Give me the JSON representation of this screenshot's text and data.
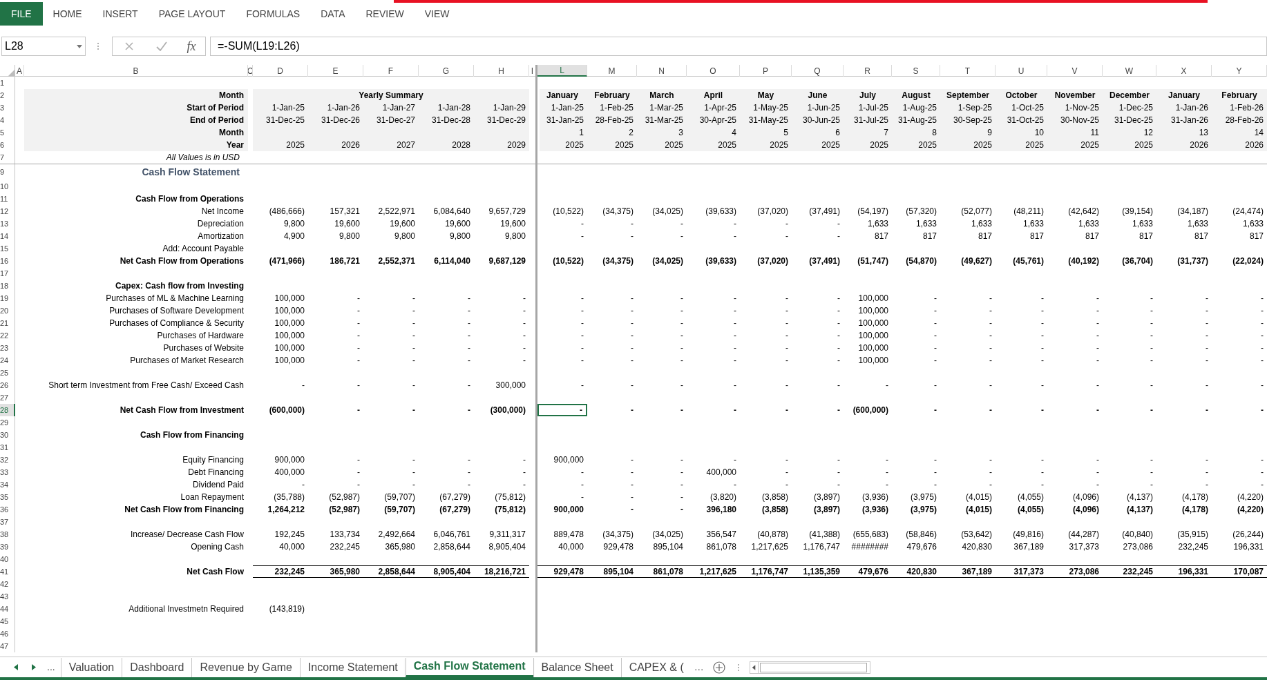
{
  "ribbon_tabs": [
    {
      "label": "FILE",
      "kind": "file"
    },
    {
      "label": "HOME",
      "kind": "tab"
    },
    {
      "label": "INSERT",
      "kind": "tab"
    },
    {
      "label": "PAGE LAYOUT",
      "kind": "tab"
    },
    {
      "label": "FORMULAS",
      "kind": "tab"
    },
    {
      "label": "DATA",
      "kind": "tab"
    },
    {
      "label": "REVIEW",
      "kind": "tab"
    },
    {
      "label": "VIEW",
      "kind": "tab"
    }
  ],
  "formula_bar": {
    "name_box": "L28",
    "function_label": "fx",
    "formula": "=-SUM(L19:L26)"
  },
  "columns": [
    {
      "label": "A",
      "selected": false
    },
    {
      "label": "B",
      "selected": false
    },
    {
      "label": "C",
      "selected": false
    },
    {
      "label": "D",
      "selected": false
    },
    {
      "label": "E",
      "selected": false
    },
    {
      "label": "F",
      "selected": false
    },
    {
      "label": "G",
      "selected": false
    },
    {
      "label": "H",
      "selected": false
    },
    {
      "label": "I",
      "selected": false
    },
    {
      "label": "L",
      "selected": true
    },
    {
      "label": "M",
      "selected": false
    },
    {
      "label": "N",
      "selected": false
    },
    {
      "label": "O",
      "selected": false
    },
    {
      "label": "P",
      "selected": false
    },
    {
      "label": "Q",
      "selected": false
    },
    {
      "label": "R",
      "selected": false
    },
    {
      "label": "S",
      "selected": false
    },
    {
      "label": "T",
      "selected": false
    },
    {
      "label": "U",
      "selected": false
    },
    {
      "label": "V",
      "selected": false
    },
    {
      "label": "W",
      "selected": false
    },
    {
      "label": "X",
      "selected": false
    },
    {
      "label": "Y",
      "selected": false
    }
  ],
  "rows": [
    {
      "num": "1",
      "kind": "blank",
      "selected": false
    },
    {
      "num": "2",
      "kind": "month_names",
      "selected": false,
      "label": "Month",
      "yearly_title": "Yearly Summary",
      "monthly": [
        "January",
        "February",
        "March",
        "April",
        "May",
        "June",
        "July",
        "August",
        "September",
        "October",
        "November",
        "December",
        "January",
        "February"
      ]
    },
    {
      "num": "3",
      "kind": "header",
      "selected": false,
      "label": "Start of Period",
      "yearly": [
        "1-Jan-25",
        "1-Jan-26",
        "1-Jan-27",
        "1-Jan-28",
        "1-Jan-29"
      ],
      "monthly": [
        "1-Jan-25",
        "1-Feb-25",
        "1-Mar-25",
        "1-Apr-25",
        "1-May-25",
        "1-Jun-25",
        "1-Jul-25",
        "1-Aug-25",
        "1-Sep-25",
        "1-Oct-25",
        "1-Nov-25",
        "1-Dec-25",
        "1-Jan-26",
        "1-Feb-26"
      ]
    },
    {
      "num": "4",
      "kind": "header",
      "selected": false,
      "label": "End of Period",
      "yearly": [
        "31-Dec-25",
        "31-Dec-26",
        "31-Dec-27",
        "31-Dec-28",
        "31-Dec-29"
      ],
      "monthly": [
        "31-Jan-25",
        "28-Feb-25",
        "31-Mar-25",
        "30-Apr-25",
        "31-May-25",
        "30-Jun-25",
        "31-Jul-25",
        "31-Aug-25",
        "30-Sep-25",
        "31-Oct-25",
        "30-Nov-25",
        "31-Dec-25",
        "31-Jan-26",
        "28-Feb-26"
      ]
    },
    {
      "num": "5",
      "kind": "header",
      "selected": false,
      "label": "Month",
      "monthly": [
        "1",
        "2",
        "3",
        "4",
        "5",
        "6",
        "7",
        "8",
        "9",
        "10",
        "11",
        "12",
        "13",
        "14"
      ]
    },
    {
      "num": "6",
      "kind": "header",
      "selected": false,
      "label": "Year",
      "yearly": [
        "2025",
        "2026",
        "2027",
        "2028",
        "2029"
      ],
      "monthly": [
        "2025",
        "2025",
        "2025",
        "2025",
        "2025",
        "2025",
        "2025",
        "2025",
        "2025",
        "2025",
        "2025",
        "2025",
        "2026",
        "2026"
      ]
    },
    {
      "num": "7",
      "kind": "note",
      "selected": false,
      "label": "All Values is in USD"
    },
    {
      "num": "9",
      "kind": "title",
      "selected": false,
      "label": "Cash Flow Statement"
    },
    {
      "num": "10",
      "kind": "blank",
      "selected": false
    },
    {
      "num": "11",
      "kind": "section",
      "selected": false,
      "label": "Cash Flow from Operations"
    },
    {
      "num": "12",
      "kind": "item",
      "selected": false,
      "label": "Net Income",
      "yearly": [
        "(486,666)",
        "157,321",
        "2,522,971",
        "6,084,640",
        "9,657,729"
      ],
      "monthly": [
        "(10,522)",
        "(34,375)",
        "(34,025)",
        "(39,633)",
        "(37,020)",
        "(37,491)",
        "(54,197)",
        "(57,320)",
        "(52,077)",
        "(48,211)",
        "(42,642)",
        "(39,154)",
        "(34,187)",
        "(24,474)"
      ]
    },
    {
      "num": "13",
      "kind": "item",
      "selected": false,
      "label": "Depreciation",
      "yearly": [
        "9,800",
        "19,600",
        "19,600",
        "19,600",
        "19,600"
      ],
      "monthly": [
        "-",
        "-",
        "-",
        "-",
        "-",
        "-",
        "1,633",
        "1,633",
        "1,633",
        "1,633",
        "1,633",
        "1,633",
        "1,633",
        "1,633"
      ]
    },
    {
      "num": "14",
      "kind": "item",
      "selected": false,
      "label": "Amortization",
      "yearly": [
        "4,900",
        "9,800",
        "9,800",
        "9,800",
        "9,800"
      ],
      "monthly": [
        "-",
        "-",
        "-",
        "-",
        "-",
        "-",
        "817",
        "817",
        "817",
        "817",
        "817",
        "817",
        "817",
        "817"
      ]
    },
    {
      "num": "15",
      "kind": "item",
      "selected": false,
      "label": "Add: Account Payable"
    },
    {
      "num": "16",
      "kind": "total",
      "selected": false,
      "label": "Net Cash Flow from Operations",
      "yearly": [
        "(471,966)",
        "186,721",
        "2,552,371",
        "6,114,040",
        "9,687,129"
      ],
      "monthly": [
        "(10,522)",
        "(34,375)",
        "(34,025)",
        "(39,633)",
        "(37,020)",
        "(37,491)",
        "(51,747)",
        "(54,870)",
        "(49,627)",
        "(45,761)",
        "(40,192)",
        "(36,704)",
        "(31,737)",
        "(22,024)"
      ]
    },
    {
      "num": "17",
      "kind": "blank",
      "selected": false
    },
    {
      "num": "18",
      "kind": "section",
      "selected": false,
      "label": "Capex: Cash flow from Investing"
    },
    {
      "num": "19",
      "kind": "item",
      "selected": false,
      "label": "Purchases of ML & Machine Learning",
      "yearly": [
        "100,000",
        "-",
        "-",
        "-",
        "-"
      ],
      "monthly": [
        "-",
        "-",
        "-",
        "-",
        "-",
        "-",
        "100,000",
        "-",
        "-",
        "-",
        "-",
        "-",
        "-",
        "-"
      ]
    },
    {
      "num": "20",
      "kind": "item",
      "selected": false,
      "label": "Purchases of Software Development",
      "yearly": [
        "100,000",
        "-",
        "-",
        "-",
        "-"
      ],
      "monthly": [
        "-",
        "-",
        "-",
        "-",
        "-",
        "-",
        "100,000",
        "-",
        "-",
        "-",
        "-",
        "-",
        "-",
        "-"
      ]
    },
    {
      "num": "21",
      "kind": "item",
      "selected": false,
      "label": "Purchases of Compliance & Security",
      "yearly": [
        "100,000",
        "-",
        "-",
        "-",
        "-"
      ],
      "monthly": [
        "-",
        "-",
        "-",
        "-",
        "-",
        "-",
        "100,000",
        "-",
        "-",
        "-",
        "-",
        "-",
        "-",
        "-"
      ]
    },
    {
      "num": "22",
      "kind": "item",
      "selected": false,
      "label": "Purchases of Hardware",
      "yearly": [
        "100,000",
        "-",
        "-",
        "-",
        "-"
      ],
      "monthly": [
        "-",
        "-",
        "-",
        "-",
        "-",
        "-",
        "100,000",
        "-",
        "-",
        "-",
        "-",
        "-",
        "-",
        "-"
      ]
    },
    {
      "num": "23",
      "kind": "item",
      "selected": false,
      "label": "Purchases of Website",
      "yearly": [
        "100,000",
        "-",
        "-",
        "-",
        "-"
      ],
      "monthly": [
        "-",
        "-",
        "-",
        "-",
        "-",
        "-",
        "100,000",
        "-",
        "-",
        "-",
        "-",
        "-",
        "-",
        "-"
      ]
    },
    {
      "num": "24",
      "kind": "item",
      "selected": false,
      "label": "Purchases of Market Research",
      "yearly": [
        "100,000",
        "-",
        "-",
        "-",
        "-"
      ],
      "monthly": [
        "-",
        "-",
        "-",
        "-",
        "-",
        "-",
        "100,000",
        "-",
        "-",
        "-",
        "-",
        "-",
        "-",
        "-"
      ]
    },
    {
      "num": "25",
      "kind": "blank",
      "selected": false
    },
    {
      "num": "26",
      "kind": "item",
      "selected": false,
      "label": "Short term Investment from Free Cash/ Exceed Cash",
      "yearly": [
        "-",
        "-",
        "-",
        "-",
        "300,000"
      ],
      "monthly": [
        "-",
        "-",
        "-",
        "-",
        "-",
        "-",
        "-",
        "-",
        "-",
        "-",
        "-",
        "-",
        "-",
        "-"
      ]
    },
    {
      "num": "27",
      "kind": "blank",
      "selected": false
    },
    {
      "num": "28",
      "kind": "total",
      "selected": true,
      "label": "Net Cash Flow from Investment",
      "yearly": [
        "(600,000)",
        "-",
        "-",
        "-",
        "(300,000)"
      ],
      "monthly": [
        "-",
        "-",
        "-",
        "-",
        "-",
        "-",
        "(600,000)",
        "-",
        "-",
        "-",
        "-",
        "-",
        "-",
        "-"
      ]
    },
    {
      "num": "29",
      "kind": "blank",
      "selected": false
    },
    {
      "num": "30",
      "kind": "section",
      "selected": false,
      "label": "Cash Flow from Financing"
    },
    {
      "num": "31",
      "kind": "blank",
      "selected": false
    },
    {
      "num": "32",
      "kind": "item",
      "selected": false,
      "label": "Equity Financing",
      "yearly": [
        "900,000",
        "-",
        "-",
        "-",
        "-"
      ],
      "monthly": [
        "900,000",
        "-",
        "-",
        "-",
        "-",
        "-",
        "-",
        "-",
        "-",
        "-",
        "-",
        "-",
        "-",
        "-"
      ]
    },
    {
      "num": "33",
      "kind": "item",
      "selected": false,
      "label": "Debt Financing",
      "yearly": [
        "400,000",
        "-",
        "-",
        "-",
        "-"
      ],
      "monthly": [
        "-",
        "-",
        "-",
        "400,000",
        "-",
        "-",
        "-",
        "-",
        "-",
        "-",
        "-",
        "-",
        "-",
        "-"
      ]
    },
    {
      "num": "34",
      "kind": "item",
      "selected": false,
      "label": "Dividend  Paid",
      "yearly": [
        "-",
        "-",
        "-",
        "-",
        "-"
      ],
      "monthly": [
        "-",
        "-",
        "-",
        "-",
        "-",
        "-",
        "-",
        "-",
        "-",
        "-",
        "-",
        "-",
        "-",
        "-"
      ]
    },
    {
      "num": "35",
      "kind": "item",
      "selected": false,
      "label": "Loan Repayment",
      "yearly": [
        "(35,788)",
        "(52,987)",
        "(59,707)",
        "(67,279)",
        "(75,812)"
      ],
      "monthly": [
        "-",
        "-",
        "-",
        "(3,820)",
        "(3,858)",
        "(3,897)",
        "(3,936)",
        "(3,975)",
        "(4,015)",
        "(4,055)",
        "(4,096)",
        "(4,137)",
        "(4,178)",
        "(4,220)"
      ]
    },
    {
      "num": "36",
      "kind": "total",
      "selected": false,
      "label": "Net Cash Flow from Financing",
      "yearly": [
        "1,264,212",
        "(52,987)",
        "(59,707)",
        "(67,279)",
        "(75,812)"
      ],
      "monthly": [
        "900,000",
        "-",
        "-",
        "396,180",
        "(3,858)",
        "(3,897)",
        "(3,936)",
        "(3,975)",
        "(4,015)",
        "(4,055)",
        "(4,096)",
        "(4,137)",
        "(4,178)",
        "(4,220)"
      ]
    },
    {
      "num": "37",
      "kind": "blank",
      "selected": false
    },
    {
      "num": "38",
      "kind": "item",
      "selected": false,
      "label": "Increase/ Decrease Cash Flow",
      "yearly": [
        "192,245",
        "133,734",
        "2,492,664",
        "6,046,761",
        "9,311,317"
      ],
      "monthly": [
        "889,478",
        "(34,375)",
        "(34,025)",
        "356,547",
        "(40,878)",
        "(41,388)",
        "(655,683)",
        "(58,846)",
        "(53,642)",
        "(49,816)",
        "(44,287)",
        "(40,840)",
        "(35,915)",
        "(26,244)"
      ]
    },
    {
      "num": "39",
      "kind": "item",
      "selected": false,
      "label": "Opening Cash",
      "yearly": [
        "40,000",
        "232,245",
        "365,980",
        "2,858,644",
        "8,905,404"
      ],
      "monthly": [
        "40,000",
        "929,478",
        "895,104",
        "861,078",
        "1,217,625",
        "1,176,747",
        "########",
        "479,676",
        "420,830",
        "367,189",
        "317,373",
        "273,086",
        "232,245",
        "196,331"
      ]
    },
    {
      "num": "40",
      "kind": "blank",
      "selected": false
    },
    {
      "num": "41",
      "kind": "net",
      "selected": false,
      "label": "Net Cash Flow",
      "yearly": [
        "232,245",
        "365,980",
        "2,858,644",
        "8,905,404",
        "18,216,721"
      ],
      "monthly": [
        "929,478",
        "895,104",
        "861,078",
        "1,217,625",
        "1,176,747",
        "1,135,359",
        "479,676",
        "420,830",
        "367,189",
        "317,373",
        "273,086",
        "232,245",
        "196,331",
        "170,087"
      ]
    },
    {
      "num": "42",
      "kind": "blank",
      "selected": false
    },
    {
      "num": "43",
      "kind": "blank",
      "selected": false
    },
    {
      "num": "44",
      "kind": "item",
      "selected": false,
      "label": "Additional Investmetn Required",
      "yearly": [
        "(143,819)"
      ]
    },
    {
      "num": "45",
      "kind": "blank",
      "selected": false
    },
    {
      "num": "46",
      "kind": "blank",
      "selected": false
    },
    {
      "num": "47",
      "kind": "blank",
      "selected": false
    }
  ],
  "sheet_tabs": [
    {
      "label": "Valuation",
      "selected": false
    },
    {
      "label": "Dashboard",
      "selected": false
    },
    {
      "label": "Revenue by Game",
      "selected": false
    },
    {
      "label": "Income Statement",
      "selected": false
    },
    {
      "label": "Cash Flow Statement",
      "selected": true
    },
    {
      "label": "Balance Sheet",
      "selected": false
    },
    {
      "label": "CAPEX & (",
      "selected": false
    }
  ],
  "sheet_nav": {
    "more_left": "...",
    "more_right": "…"
  }
}
